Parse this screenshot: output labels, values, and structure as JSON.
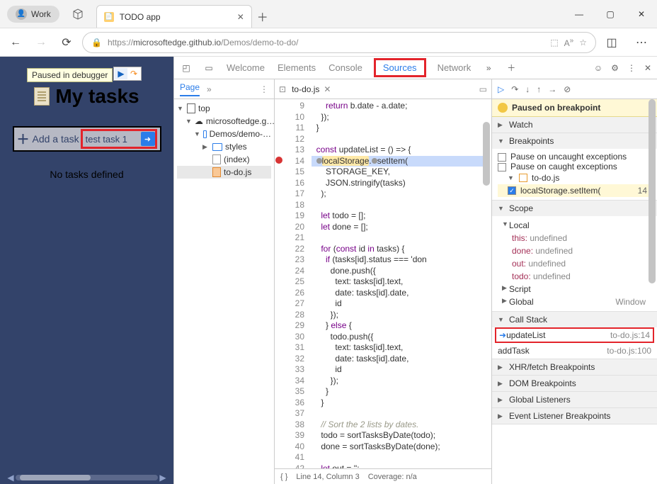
{
  "title_bar": {
    "profile_label": "Work",
    "tab_title": "TODO app"
  },
  "url_bar": {
    "host": "microsoftedge.github.io",
    "scheme": "https://",
    "path": "/Demos/demo-to-do/"
  },
  "page": {
    "pause_notice": "Paused in debugger",
    "heading": "My tasks",
    "add_label": "Add a task",
    "input_value": "test task 1",
    "empty_text": "No tasks defined"
  },
  "devtools_tabs": {
    "welcome": "Welcome",
    "elements": "Elements",
    "console": "Console",
    "sources": "Sources",
    "network": "Network"
  },
  "navigator": {
    "page_tab": "Page",
    "top": "top",
    "origin": "microsoftedge.g…",
    "folder": "Demos/demo-…",
    "styles": "styles",
    "index": "(index)",
    "todo_js": "to-do.js"
  },
  "editor": {
    "tab_name": "to-do.js",
    "status_pos": "Line 14, Column 3",
    "status_cov": "Coverage: n/a",
    "code_lines": [
      "      return b.date - a.date;",
      "    });",
      "  }",
      "",
      "  const updateList = () => {",
      "    localStorage.setItem(",
      "      STORAGE_KEY,",
      "      JSON.stringify(tasks)",
      "    );",
      "",
      "    let todo = [];",
      "    let done = [];",
      "",
      "    for (const id in tasks) {",
      "      if (tasks[id].status === 'don",
      "        done.push({",
      "          text: tasks[id].text,",
      "          date: tasks[id].date,",
      "          id",
      "        });",
      "      } else {",
      "        todo.push({",
      "          text: tasks[id].text,",
      "          date: tasks[id].date,",
      "          id",
      "        });",
      "      }",
      "    }",
      "",
      "    // Sort the 2 lists by dates.",
      "    todo = sortTasksByDate(todo);",
      "    done = sortTasksByDate(done);",
      "",
      "    let out = '';"
    ],
    "first_line_no": 9,
    "breakpoint_line": 14
  },
  "debugger": {
    "paused_msg": "Paused on breakpoint",
    "watch": "Watch",
    "breakpoints_label": "Breakpoints",
    "pause_uncaught": "Pause on uncaught exceptions",
    "pause_caught": "Pause on caught exceptions",
    "bp_file": "to-do.js",
    "bp_code": "localStorage.setItem(",
    "bp_line_no": "14",
    "scope_label": "Scope",
    "local": "Local",
    "scope_vars": [
      {
        "k": "this:",
        "v": "undefined"
      },
      {
        "k": "done:",
        "v": "undefined"
      },
      {
        "k": "out:",
        "v": "undefined"
      },
      {
        "k": "todo:",
        "v": "undefined"
      }
    ],
    "script_label": "Script",
    "global_label": "Global",
    "global_val": "Window",
    "callstack_label": "Call Stack",
    "callstack": [
      {
        "fn": "updateList",
        "loc": "to-do.js:14",
        "current": true
      },
      {
        "fn": "addTask",
        "loc": "to-do.js:100",
        "current": false
      }
    ],
    "xhr_bp": "XHR/fetch Breakpoints",
    "dom_bp": "DOM Breakpoints",
    "glob_listeners": "Global Listeners",
    "evt_bp": "Event Listener Breakpoints"
  }
}
